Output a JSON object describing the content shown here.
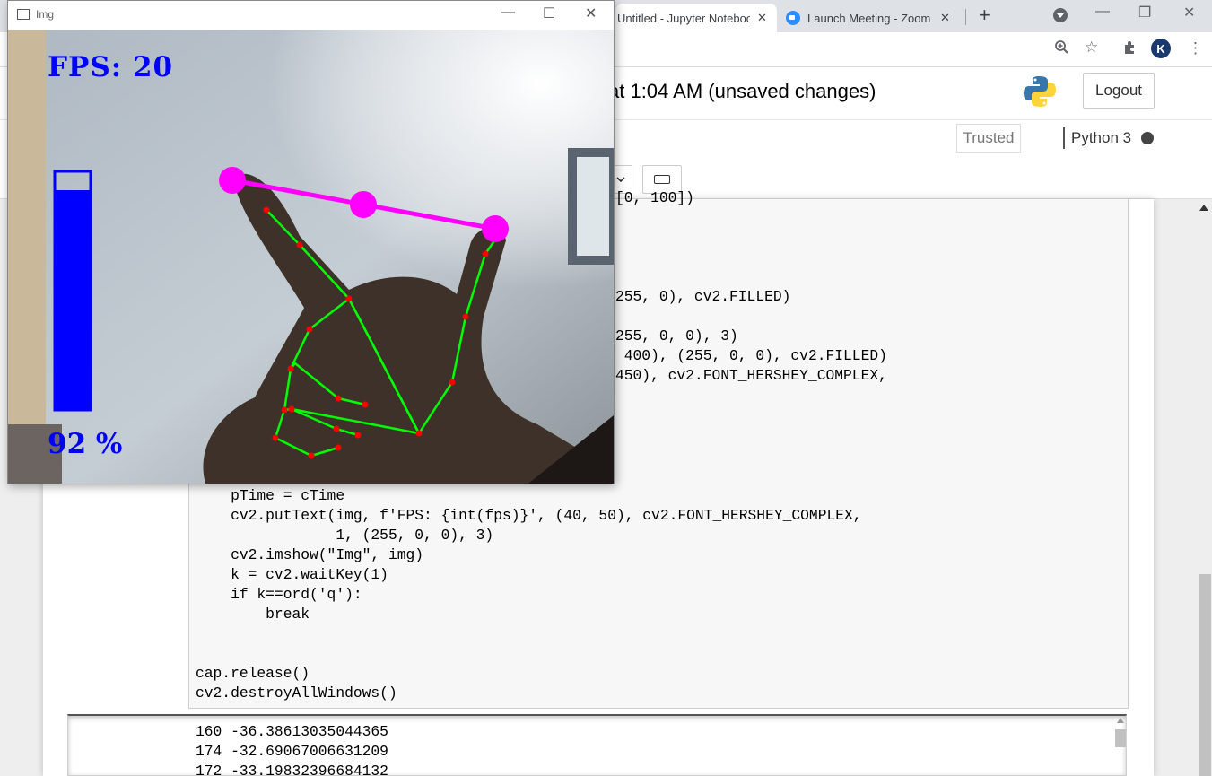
{
  "browser": {
    "tabs": [
      {
        "label": "Untitled - Jupyter Notebook",
        "active": true
      },
      {
        "label": "Launch Meeting - Zoom",
        "active": false
      }
    ],
    "new_tab": "+",
    "window_controls": {
      "minimize": "—",
      "restore": "❐",
      "close": "✕"
    },
    "toolbar_icons": [
      "zoom-icon",
      "star-icon",
      "extensions-icon",
      "profile-avatar",
      "menu-icon"
    ],
    "profile_initial": "K"
  },
  "jupyter": {
    "save_status": "at 1:04 AM  (unsaved changes)",
    "logout": "Logout",
    "trusted": "Trusted",
    "kernel": "Python 3"
  },
  "code_visible_fragments": {
    "line1": "[0, 100])",
    "line2": "255, 0), cv2.FILLED)",
    "line3": "255, 0, 0), 3)",
    "line4": " 400), (255, 0, 0), cv2.FILLED)",
    "line5": "450), cv2.FONT_HERSHEY_COMPLEX,"
  },
  "code_lines": [
    "    pTime = cTime",
    "    cv2.putText(img, f'FPS: {int(fps)}', (40, 50), cv2.FONT_HERSHEY_COMPLEX,",
    "                1, (255, 0, 0), 3)",
    "    cv2.imshow(\"Img\", img)",
    "    k = cv2.waitKey(1)",
    "    if k==ord('q'):",
    "        break",
    "",
    "",
    "cap.release()",
    "cv2.destroyAllWindows()"
  ],
  "output_lines": [
    "160 -36.38613035044365",
    "174 -32.69067006631209",
    "172 -33.19832396684132"
  ],
  "img_window": {
    "title": "Img",
    "fps_label": "FPS: 20",
    "volume_label": "92 %",
    "volume_level_percent": 92,
    "colors": {
      "overlay_text": "#0000ff",
      "landmark": "#ff0000",
      "connection": "#00ff00",
      "pinch_line": "#ff00ff"
    }
  }
}
